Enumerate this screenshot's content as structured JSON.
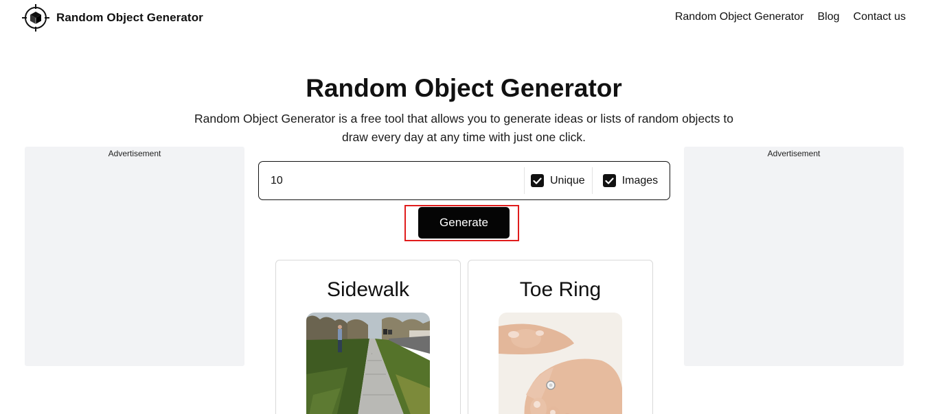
{
  "header": {
    "logo_text": "Random Object Generator",
    "logo_icon": "cube-crosshair-icon",
    "nav": [
      {
        "label": "Random Object Generator"
      },
      {
        "label": "Blog"
      },
      {
        "label": "Contact us"
      }
    ]
  },
  "hero": {
    "title": "Random Object Generator",
    "description": "Random Object Generator is a free tool that allows you to generate ideas or lists of random objects to draw every day at any time with just one click."
  },
  "ads": {
    "left_label": "Advertisement",
    "right_label": "Advertisement"
  },
  "form": {
    "count_value": "10",
    "unique": {
      "label": "Unique",
      "checked": true
    },
    "images": {
      "label": "Images",
      "checked": true
    },
    "generate_label": "Generate"
  },
  "results": [
    {
      "title": "Sidewalk",
      "image": "sidewalk-photo"
    },
    {
      "title": "Toe Ring",
      "image": "toe-ring-photo"
    }
  ],
  "colors": {
    "button_bg": "#050505",
    "ad_bg": "#f2f3f5",
    "focus_outline": "#e01b1b"
  }
}
